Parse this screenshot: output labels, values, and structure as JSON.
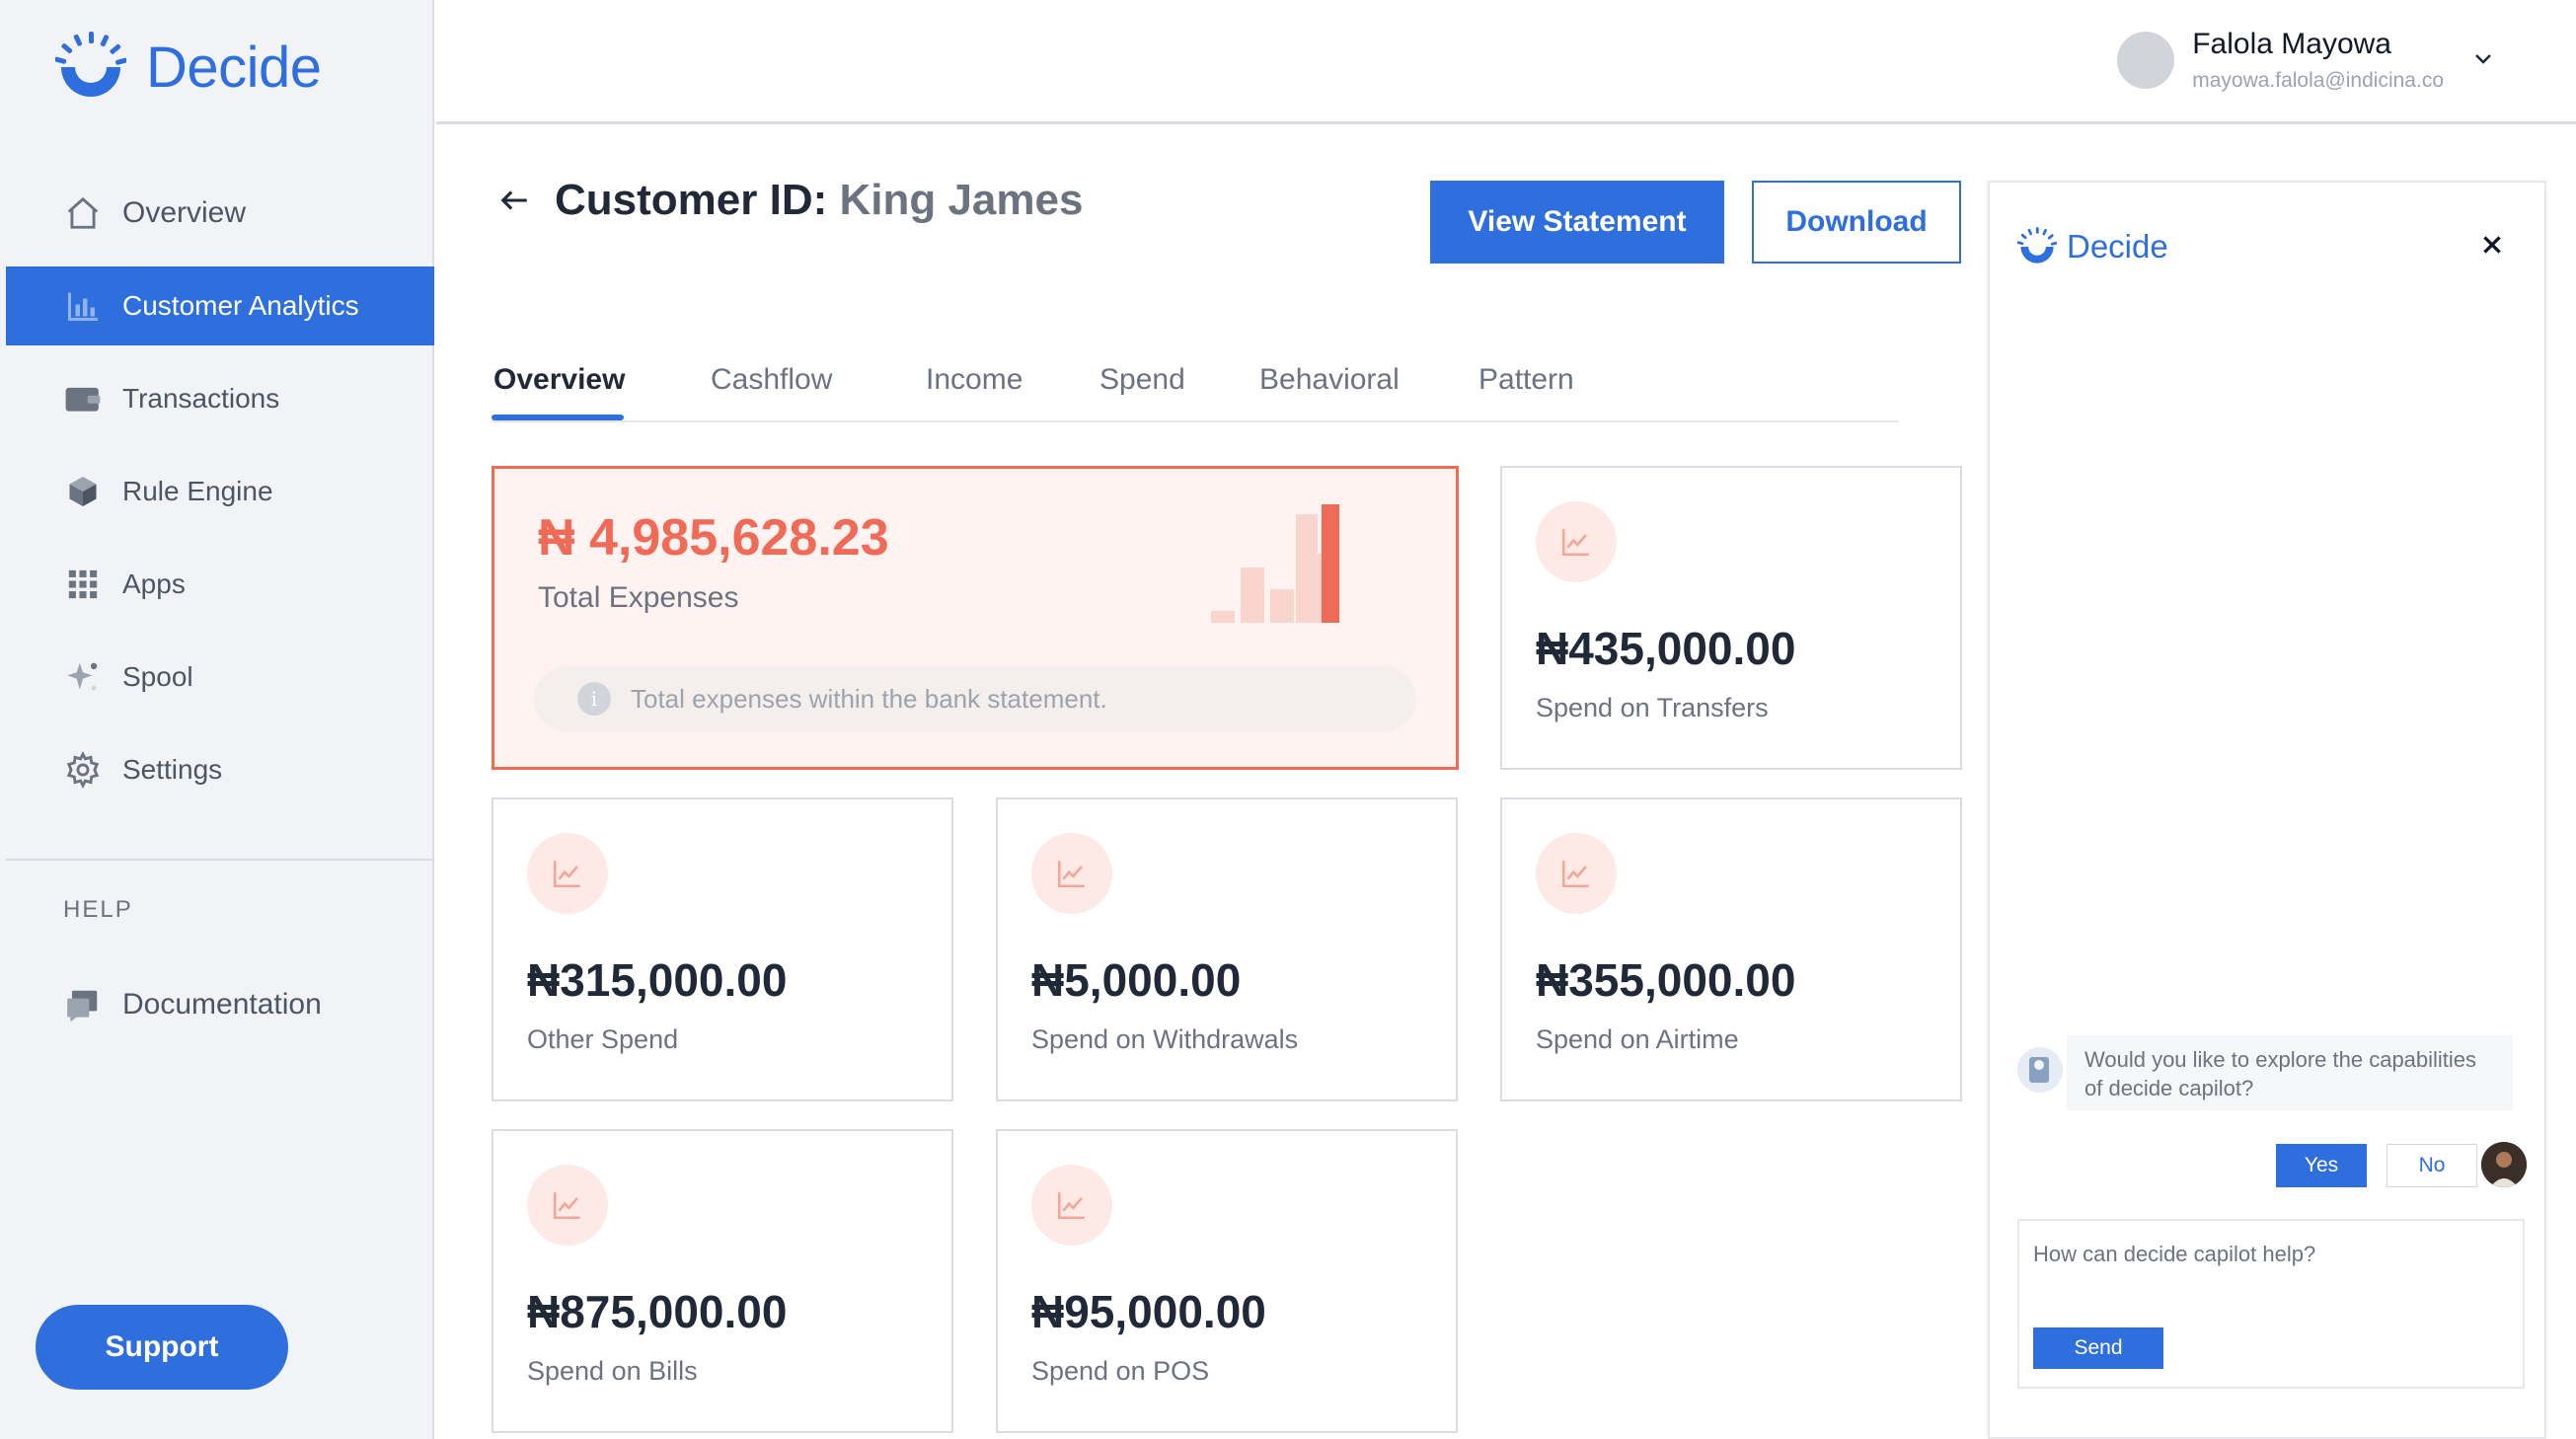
{
  "app": {
    "brand": "Decide",
    "brand_color": "#2f6fdd",
    "accent_color": "#ef6b57"
  },
  "sidebar": {
    "items": [
      {
        "label": "Overview",
        "icon": "home-icon",
        "active": false
      },
      {
        "label": "Customer Analytics",
        "icon": "bar-chart-icon",
        "active": true
      },
      {
        "label": "Transactions",
        "icon": "wallet-icon",
        "active": false
      },
      {
        "label": "Rule Engine",
        "icon": "cube-icon",
        "active": false
      },
      {
        "label": "Apps",
        "icon": "grid-icon",
        "active": false
      },
      {
        "label": "Spool",
        "icon": "sparkle-icon",
        "active": false
      },
      {
        "label": "Settings",
        "icon": "gear-icon",
        "active": false
      }
    ],
    "help_label": "HELP",
    "help_items": [
      {
        "label": "Documentation",
        "icon": "document-icon"
      }
    ],
    "support_label": "Support"
  },
  "header": {
    "user_name": "Falola Mayowa",
    "user_email": "mayowa.falola@indicina.co"
  },
  "page": {
    "title_prefix": "Customer ID:",
    "customer_name": "King James",
    "view_statement_label": "View Statement",
    "download_label": "Download",
    "tabs": [
      {
        "label": "Overview",
        "active": true
      },
      {
        "label": "Cashflow",
        "active": false
      },
      {
        "label": "Income",
        "active": false
      },
      {
        "label": "Spend",
        "active": false
      },
      {
        "label": "Behavioral",
        "active": false
      },
      {
        "label": "Pattern",
        "active": false
      }
    ]
  },
  "total_expenses": {
    "amount": "₦ 4,985,628.23",
    "label": "Total Expenses",
    "info": "Total expenses within the bank statement."
  },
  "stats": [
    {
      "amount": "₦435,000.00",
      "label": "Spend on Transfers"
    },
    {
      "amount": "₦315,000.00",
      "label": "Other Spend"
    },
    {
      "amount": "₦5,000.00",
      "label": "Spend on Withdrawals"
    },
    {
      "amount": "₦355,000.00",
      "label": "Spend on Airtime"
    },
    {
      "amount": "₦875,000.00",
      "label": "Spend on Bills"
    },
    {
      "amount": "₦95,000.00",
      "label": "Spend on POS"
    }
  ],
  "copilot": {
    "brand": "Decide",
    "bot_message": "Would you like to explore the capabilities of decide capilot?",
    "yes_label": "Yes",
    "no_label": "No",
    "input_placeholder": "How can decide capilot help?",
    "send_label": "Send"
  }
}
